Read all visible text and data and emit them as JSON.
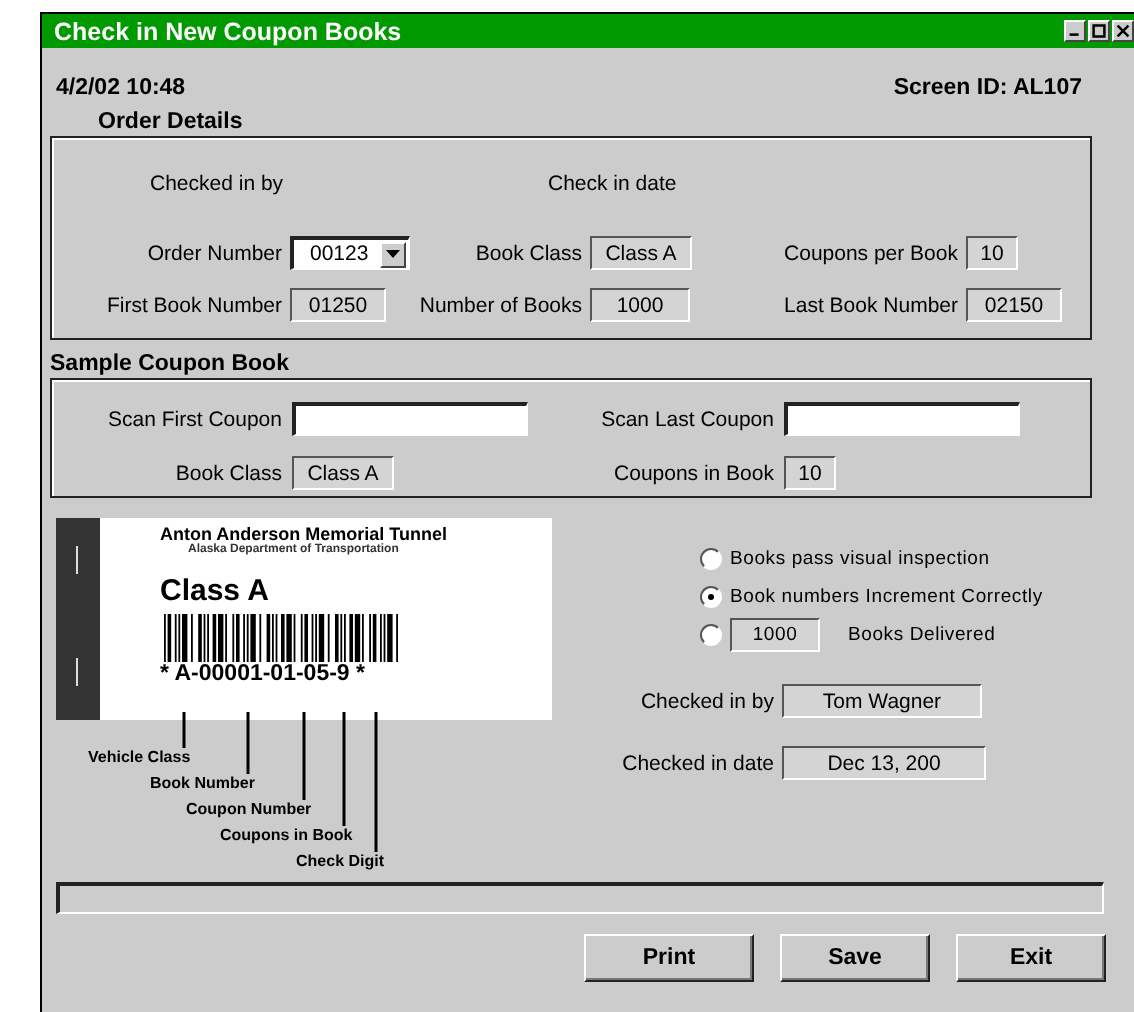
{
  "window": {
    "title": "Check in New Coupon Books"
  },
  "header": {
    "timestamp": "4/2/02 10:48",
    "screen_id": "Screen ID: AL107"
  },
  "order_details": {
    "title": "Order Details",
    "checked_in_by_label": "Checked in by",
    "check_in_date_label": "Check in date",
    "fields": [
      {
        "label": "Order Number",
        "value": "00123",
        "kind": "dropdown"
      },
      {
        "label": "Book Class",
        "value": "Class A",
        "kind": "readonly"
      },
      {
        "label": "Coupons per Book",
        "value": "10",
        "kind": "readonly"
      },
      {
        "label": "First Book Number",
        "value": "01250",
        "kind": "readonly"
      },
      {
        "label": "Number of Books",
        "value": "1000",
        "kind": "readonly"
      },
      {
        "label": "Last Book Number",
        "value": "02150",
        "kind": "readonly"
      }
    ]
  },
  "sample_coupon_book": {
    "title": "Sample Coupon Book",
    "fields": [
      {
        "label": "Scan First Coupon",
        "kind": "input"
      },
      {
        "label": "Scan Last Coupon",
        "kind": "input"
      },
      {
        "label": "Book Class",
        "value": "Class A",
        "kind": "readonly"
      },
      {
        "label": "Coupons in Book",
        "value": "10",
        "kind": "readonly"
      }
    ]
  },
  "coupon": {
    "agency": "Anton Anderson Memorial Tunnel",
    "department": "Alaska Department of Transportation",
    "class": "Class A",
    "code": "* A-00001-01-05-9 *",
    "annotations": [
      "Vehicle Class",
      "Book Number",
      "Coupon Number",
      "Coupons in Book",
      "Check Digit"
    ]
  },
  "checks": [
    {
      "kind": "radio",
      "label": "Books pass visual inspection",
      "selected": false
    },
    {
      "kind": "radio",
      "label": "Book numbers Increment Correctly",
      "selected": true
    },
    {
      "kind": "count",
      "value": "1000",
      "label": "Books Delivered",
      "selected": false
    }
  ],
  "checked_in_by": {
    "label": "Checked in by",
    "value": "Tom Wagner"
  },
  "checked_in_date": {
    "label": "Checked in date",
    "value": "Dec 13, 200"
  },
  "buttons": [
    "Print",
    "Save",
    "Exit"
  ]
}
